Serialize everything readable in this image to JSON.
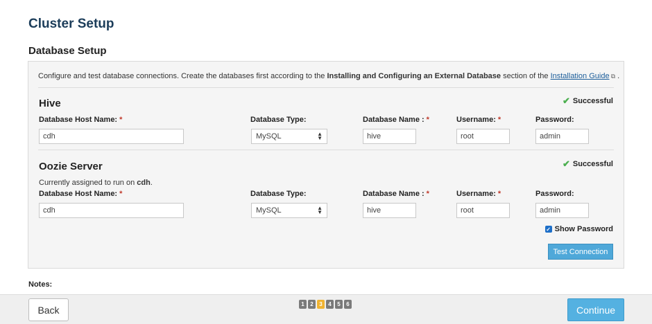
{
  "page": {
    "title": "Cluster Setup",
    "section": "Database Setup"
  },
  "intro": {
    "prefix": "Configure and test database connections. Create the databases first according to the ",
    "bold": "Installing and Configuring an External Database",
    "middle": " section of the ",
    "link": "Installation Guide",
    "suffix": " ."
  },
  "labels": {
    "host": "Database Host Name:",
    "type": "Database Type:",
    "dbname": "Database Name :",
    "username": "Username:",
    "password": "Password:",
    "required": "*"
  },
  "hive": {
    "title": "Hive",
    "status": "Successful",
    "host": "cdh",
    "type": "MySQL",
    "dbname": "hive",
    "username": "root",
    "password": "admin"
  },
  "oozie": {
    "title": "Oozie Server",
    "assigned_prefix": "Currently assigned to run on ",
    "assigned_host": "cdh",
    "assigned_suffix": ".",
    "status": "Successful",
    "host": "cdh",
    "type": "MySQL",
    "dbname": "hive",
    "username": "root",
    "password": "admin"
  },
  "show_password": "Show Password",
  "test_connection": "Test Connection",
  "notes": "Notes:",
  "footer": {
    "back": "Back",
    "continue": "Continue",
    "steps": [
      "1",
      "2",
      "3",
      "4",
      "5",
      "6"
    ],
    "active_step": "3"
  },
  "colors": {
    "title": "#1c3d5a",
    "primary": "#54b1e1",
    "success": "#4caf50",
    "active_step": "#f0b331"
  }
}
